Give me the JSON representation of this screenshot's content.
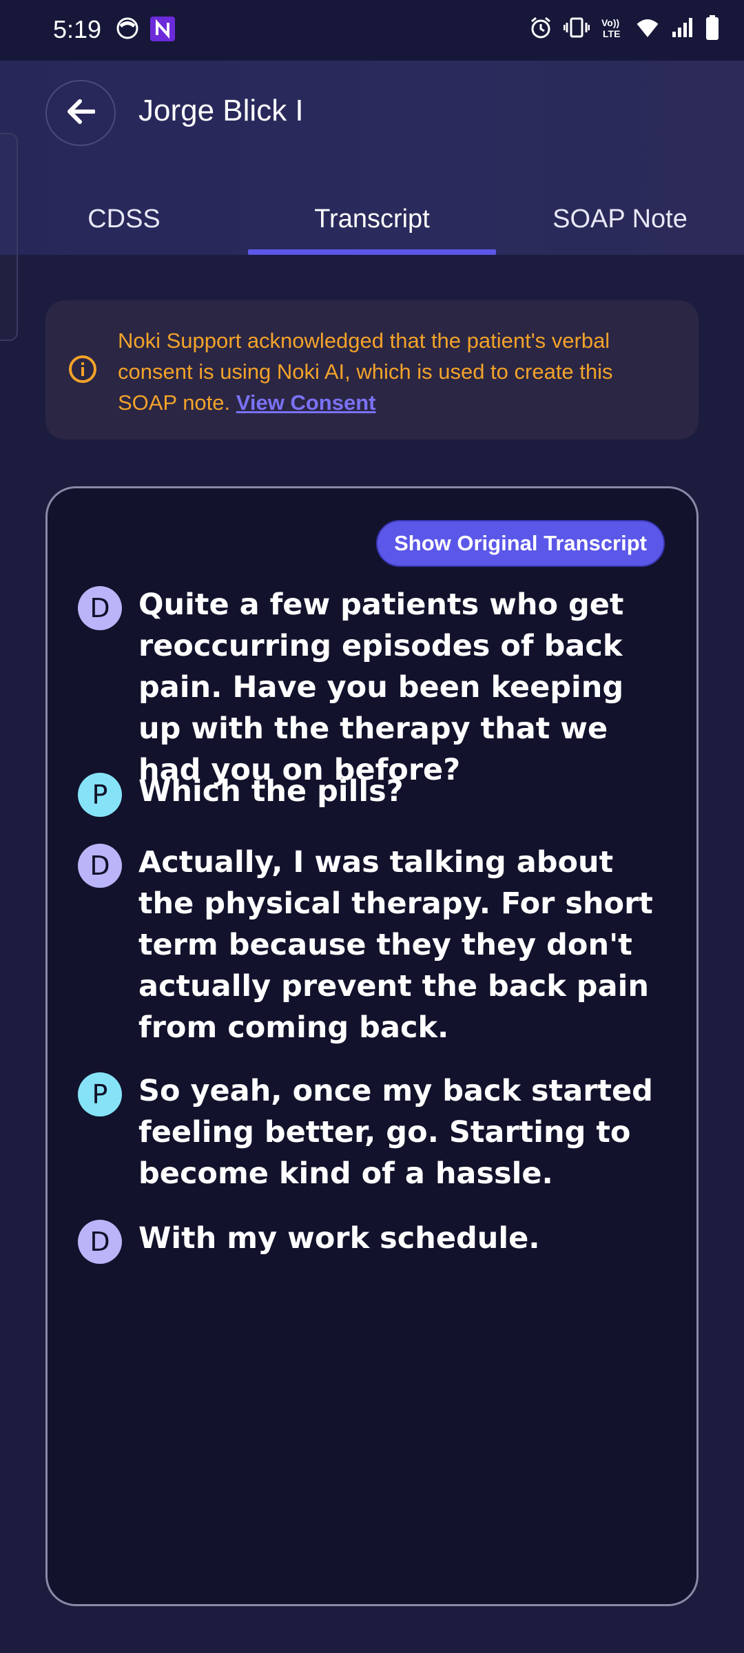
{
  "status_bar": {
    "time": "5:19",
    "icons": [
      "app-face-icon",
      "app-n-icon",
      "alarm-icon",
      "vibrate-icon",
      "volte-icon",
      "wifi-icon",
      "signal-icon",
      "battery-icon"
    ],
    "volte_label": "VoLTE"
  },
  "header": {
    "patient_name": "Jorge Blick I",
    "back_icon": "arrow-left-icon"
  },
  "tabs": [
    {
      "label": "CDSS",
      "active": false
    },
    {
      "label": "Transcript",
      "active": true
    },
    {
      "label": "SOAP Note",
      "active": false
    }
  ],
  "consent_banner": {
    "text": "Noki Support acknowledged that the patient's verbal consent is using Noki AI, which is used to create this SOAP note. ",
    "link_label": "View Consent",
    "icon": "info-icon"
  },
  "transcript": {
    "toggle_label": "Show Original Transcript",
    "messages": [
      {
        "speaker": "D",
        "text": "Quite a few patients who get reoccurring episodes of back pain. Have you been keeping up with the therapy that we had you on before?"
      },
      {
        "speaker": "P",
        "text": "Which the pills?"
      },
      {
        "speaker": "D",
        "text": "Actually, I was talking about the physical therapy. For short term because they they don't actually prevent the back pain from coming back."
      },
      {
        "speaker": "P",
        "text": "So yeah, once my back started feeling better, go. Starting to become kind of a hassle."
      },
      {
        "speaker": "D",
        "text": "With my work schedule."
      }
    ]
  },
  "colors": {
    "background": "#1c1c3e",
    "accent": "#5b57e8",
    "consent_text": "#f3a32a",
    "doctor_avatar": "#b9b5f8",
    "patient_avatar": "#86e3f7"
  }
}
